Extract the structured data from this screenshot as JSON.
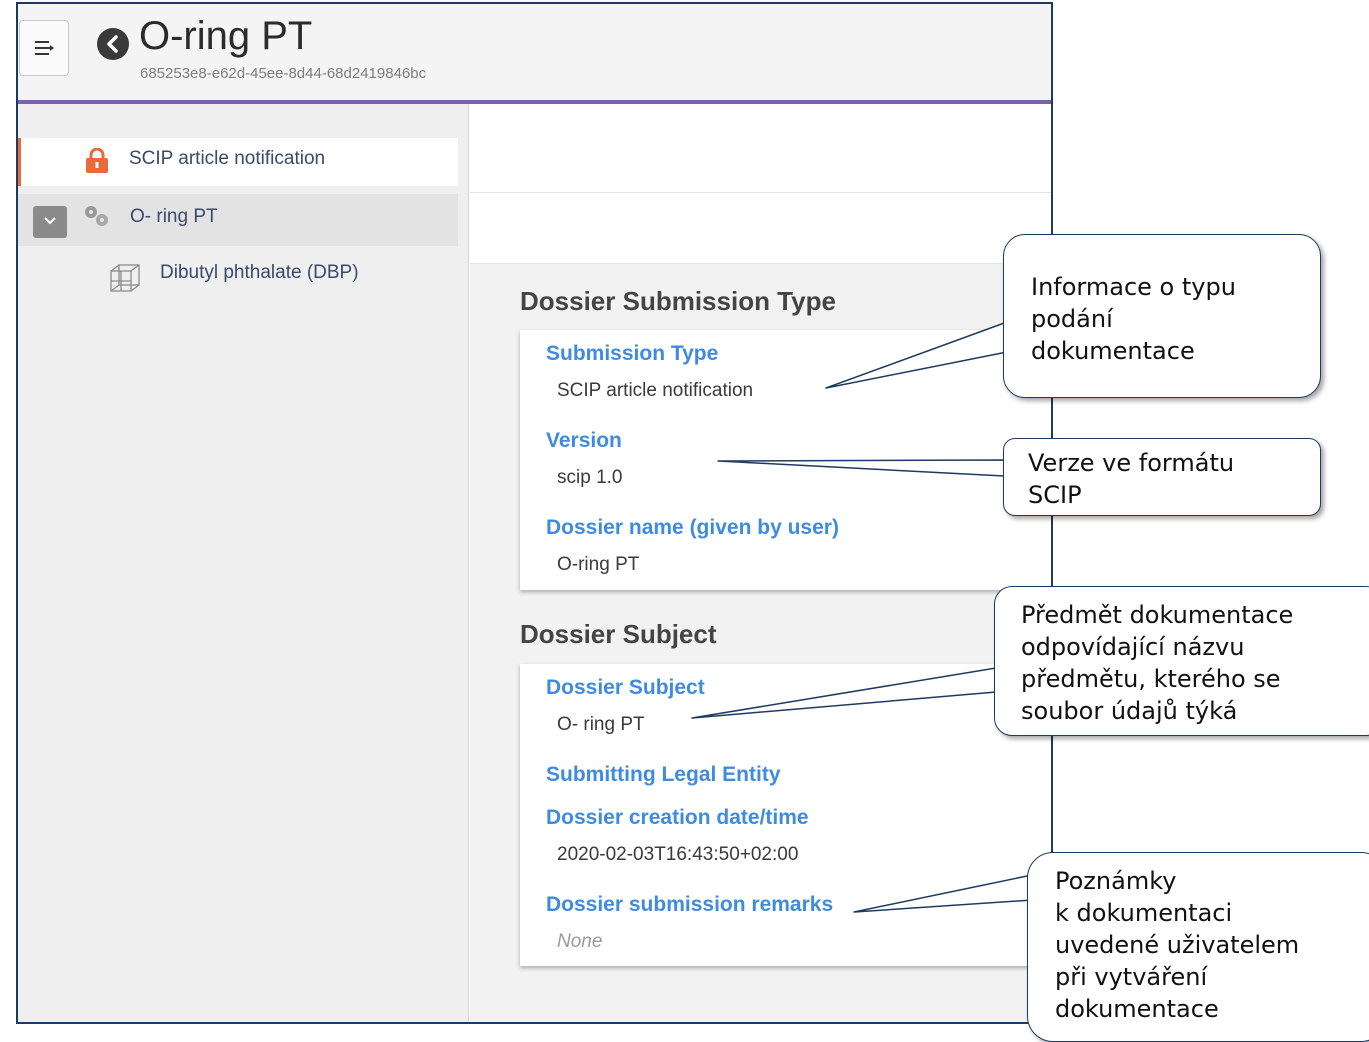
{
  "header": {
    "title": "O-ring PT",
    "uuid": "685253e8-e62d-45ee-8d44-68d2419846bc"
  },
  "sidebar": {
    "items": [
      {
        "label": "SCIP article notification",
        "icon": "lock-icon"
      },
      {
        "label": "O- ring PT",
        "icon": "article-icon"
      },
      {
        "label": "Dibutyl phthalate (DBP)",
        "icon": "substance-icon"
      }
    ]
  },
  "main": {
    "sections": [
      {
        "title": "Dossier Submission Type",
        "fields": [
          {
            "label": "Submission Type",
            "value": "SCIP article notification"
          },
          {
            "label": "Version",
            "value": "scip 1.0"
          },
          {
            "label": "Dossier name (given by user)",
            "value": "O-ring PT"
          }
        ]
      },
      {
        "title": "Dossier Subject",
        "fields": [
          {
            "label": "Dossier Subject",
            "value": "O- ring PT"
          },
          {
            "label": "Submitting Legal Entity",
            "value": ""
          },
          {
            "label": "Dossier creation date/time",
            "value": "2020-02-03T16:43:50+02:00"
          },
          {
            "label": "Dossier submission remarks",
            "value": "None"
          }
        ]
      }
    ]
  },
  "callouts": [
    {
      "text": "Informace o typu\npodání\ndokumentace"
    },
    {
      "text": "Verze ve formátu\nSCIP"
    },
    {
      "text": "Předmět dokumentace\nodpovídající názvu\npředmětu, kterého se\nsoubor údajů týká"
    },
    {
      "text": "Poznámky\nk dokumentaci\nuvedené uživatelem\npři vytváření\ndokumentace"
    }
  ],
  "colors": {
    "accent_purple": "#7a63a8",
    "label_blue": "#3f8be0",
    "lock_orange": "#e96a3b",
    "callout_border": "#1f3a5f"
  }
}
